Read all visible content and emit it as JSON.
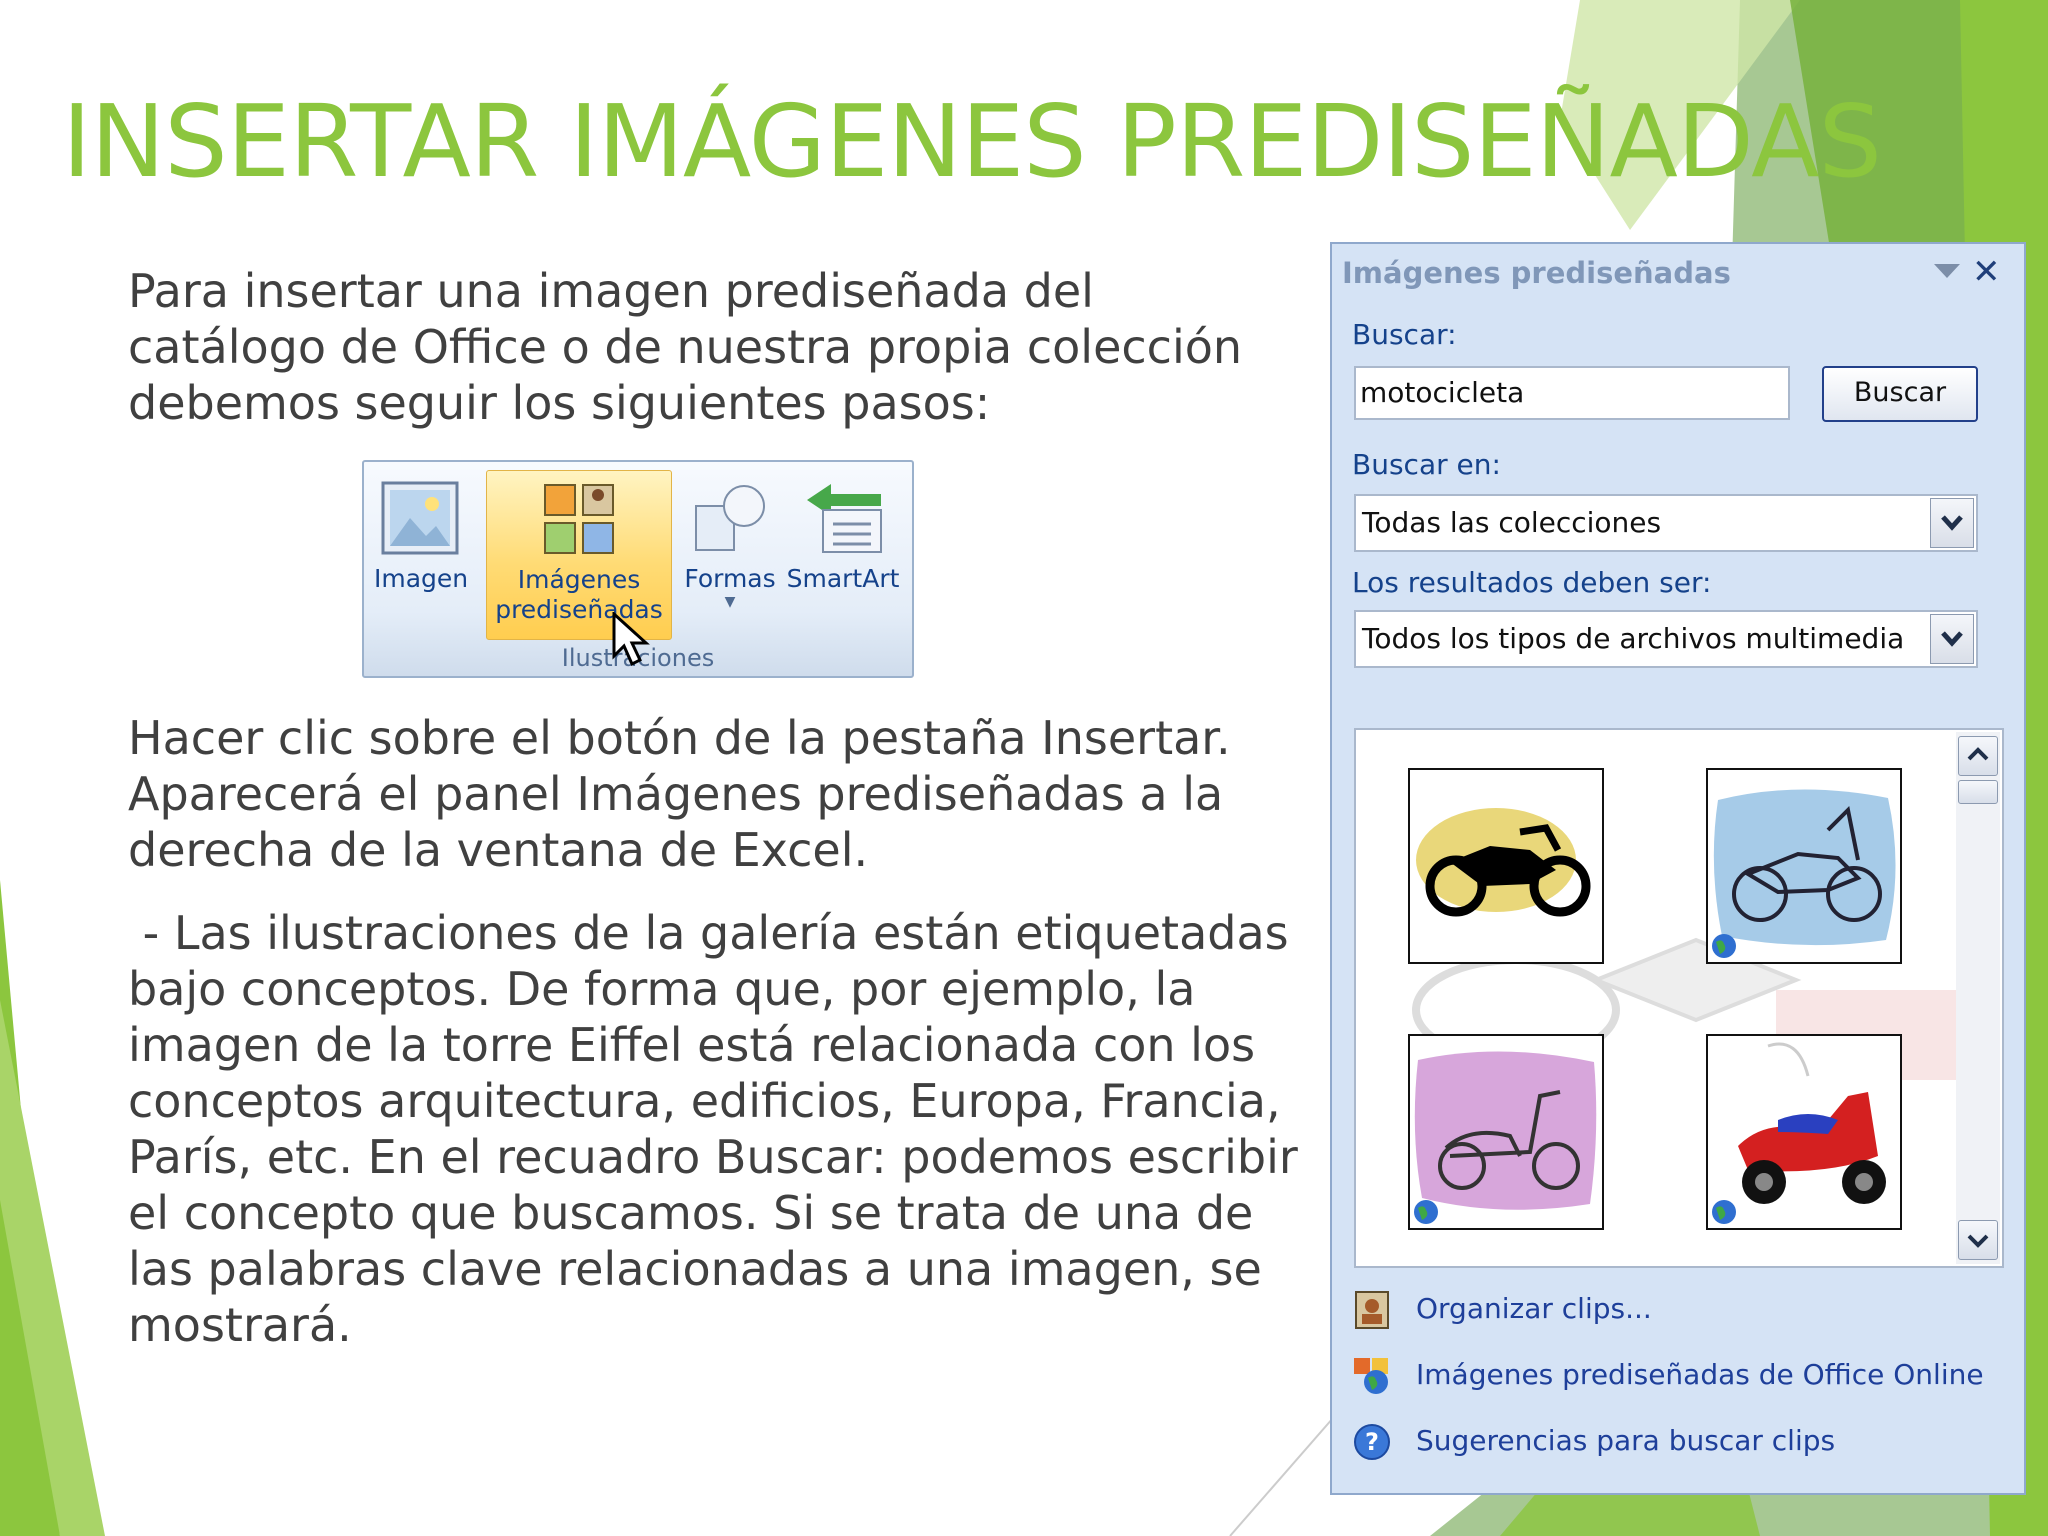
{
  "slide": {
    "title": "INSERTAR IMÁGENES PREDISEÑADAS",
    "intro": "Para insertar una imagen prediseñada del catálogo de Office o de nuestra propia colección debemos seguir los siguientes pasos:",
    "para1": "Hacer clic sobre el botón de la pestaña Insertar. Aparecerá el panel Imágenes prediseñadas a la derecha de la ventana de Excel.",
    "para2": " - Las ilustraciones de la galería están etiquetadas bajo conceptos. De forma que, por ejemplo, la imagen de la torre Eiffel está relacionada con los conceptos arquitectura, edificios, Europa, Francia, París, etc. En el recuadro Buscar: podemos escribir el concepto que buscamos. Si se trata de una de las palabras clave relacionadas a una imagen, se mostrará.",
    "accent_color": "#8cc63e"
  },
  "ribbon": {
    "group_label": "Ilustraciones",
    "buttons": [
      {
        "label": "Imagen",
        "icon": "picture-icon"
      },
      {
        "label": "Imágenes prediseñadas",
        "icon": "clip-art-icon",
        "active": true
      },
      {
        "label": "Formas",
        "icon": "shapes-icon"
      },
      {
        "label": "SmartArt",
        "icon": "smartart-icon"
      }
    ]
  },
  "taskpane": {
    "title": "Imágenes prediseñadas",
    "search_label": "Buscar:",
    "search_value": "motocicleta",
    "search_button": "Buscar",
    "search_in_label": "Buscar en:",
    "search_in_value": "Todas las colecciones",
    "results_label": "Los resultados deben ser:",
    "results_value": "Todos los tipos de archivos multimedia",
    "results_thumbs": [
      "motorcycle-yellow-clipart",
      "motorcycle-blue-clipart",
      "scooter-pink-clipart",
      "scooter-red-clipart"
    ],
    "links": [
      {
        "label": "Organizar clips...",
        "icon": "organize-clips-icon"
      },
      {
        "label": "Imágenes prediseñadas de Office Online",
        "icon": "office-online-icon"
      },
      {
        "label": "Sugerencias para buscar clips",
        "icon": "help-icon"
      }
    ]
  }
}
